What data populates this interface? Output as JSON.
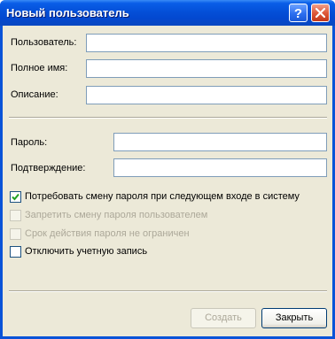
{
  "window": {
    "title": "Новый пользователь"
  },
  "form": {
    "username": {
      "label": "Пользователь:",
      "value": ""
    },
    "fullname": {
      "label": "Полное имя:",
      "value": ""
    },
    "description": {
      "label": "Описание:",
      "value": ""
    },
    "password": {
      "label": "Пароль:",
      "value": ""
    },
    "confirm": {
      "label": "Подтверждение:",
      "value": ""
    }
  },
  "options": [
    {
      "label": "Потребовать смену пароля при следующем входе в систему",
      "checked": true,
      "enabled": true
    },
    {
      "label": "Запретить смену пароля пользователем",
      "checked": false,
      "enabled": false
    },
    {
      "label": "Срок действия пароля не ограничен",
      "checked": false,
      "enabled": false
    },
    {
      "label": "Отключить учетную запись",
      "checked": false,
      "enabled": true
    }
  ],
  "buttons": {
    "create": {
      "label": "Создать",
      "enabled": false
    },
    "close": {
      "label": "Закрыть",
      "enabled": true
    }
  },
  "icons": {
    "help": "help-icon",
    "close": "close-icon"
  },
  "colors": {
    "titlebar": "#0450d8",
    "dialog_bg": "#ece9d8",
    "field_border": "#7f9db9",
    "close_button": "#de5a3c"
  }
}
